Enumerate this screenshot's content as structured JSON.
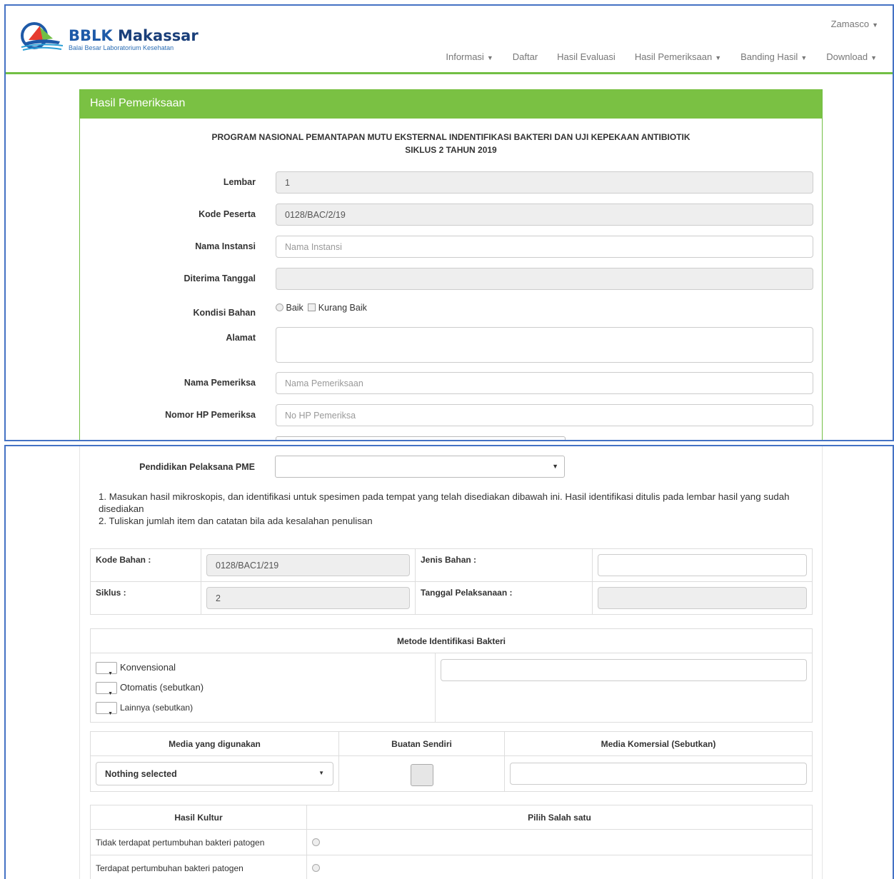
{
  "brand": {
    "name_part1": "BBLK",
    "name_part2": " Makassar",
    "subtitle": "Balai Besar Laboratorium Kesehatan"
  },
  "user_menu": "Zamasco",
  "nav": [
    "Informasi",
    "Daftar",
    "Hasil Evaluasi",
    "Hasil Pemeriksaan",
    "Banding Hasil",
    "Download"
  ],
  "panel": {
    "heading": "Hasil Pemeriksaan",
    "title_line1": "PROGRAM NASIONAL PEMANTAPAN MUTU EKSTERNAL INDENTIFIKASI BAKTERI DAN UJI KEPEKAAN ANTIBIOTIK",
    "title_line2": "SIKLUS 2 TAHUN 2019"
  },
  "form": {
    "lembar": {
      "label": "Lembar",
      "value": "1"
    },
    "kode_peserta": {
      "label": "Kode Peserta",
      "value": "0128/BAC/2/19"
    },
    "nama_instansi": {
      "label": "Nama Instansi",
      "placeholder": "Nama Instansi"
    },
    "diterima_tanggal": {
      "label": "Diterima Tanggal",
      "value": ""
    },
    "kondisi_bahan": {
      "label": "Kondisi Bahan",
      "opt1": "Baik",
      "opt2": "Kurang Baik"
    },
    "alamat": {
      "label": "Alamat"
    },
    "nama_pemeriksa": {
      "label": "Nama Pemeriksa",
      "placeholder": "Nama Pemeriksaan"
    },
    "nomor_hp": {
      "label": "Nomor HP Pemeriksa",
      "placeholder": "No HP Pemeriksa"
    },
    "pendidikan": {
      "label": "Pendidikan Pelaksana PME"
    }
  },
  "instructions": [
    "1. Masukan hasil mikroskopis, dan identifikasi untuk spesimen pada tempat yang telah disediakan dibawah ini. Hasil identifikasi ditulis pada lembar hasil yang sudah disediakan",
    "2. Tuliskan jumlah item dan catatan bila ada kesalahan penulisan"
  ],
  "bahan": {
    "kode_label": "Kode Bahan :",
    "kode_value": "0128/BAC1/219",
    "jenis_label": "Jenis Bahan :",
    "siklus_label": "Siklus :",
    "siklus_value": "2",
    "tanggal_label": "Tanggal Pelaksanaan :"
  },
  "metode": {
    "header": "Metode Identifikasi Bakteri",
    "opt1": "Konvensional",
    "opt2": "Otomatis (sebutkan)",
    "opt3": "Lainnya (sebutkan)"
  },
  "media": {
    "col1": "Media yang digunakan",
    "col2": "Buatan Sendiri",
    "col3": "Media Komersial (Sebutkan)",
    "select_value": "Nothing selected"
  },
  "kultur": {
    "col1": "Hasil Kultur",
    "col2": "Pilih Salah satu",
    "row1": "Tidak terdapat pertumbuhan bakteri patogen",
    "row2": "Terdapat pertumbuhan bakteri patogen"
  }
}
